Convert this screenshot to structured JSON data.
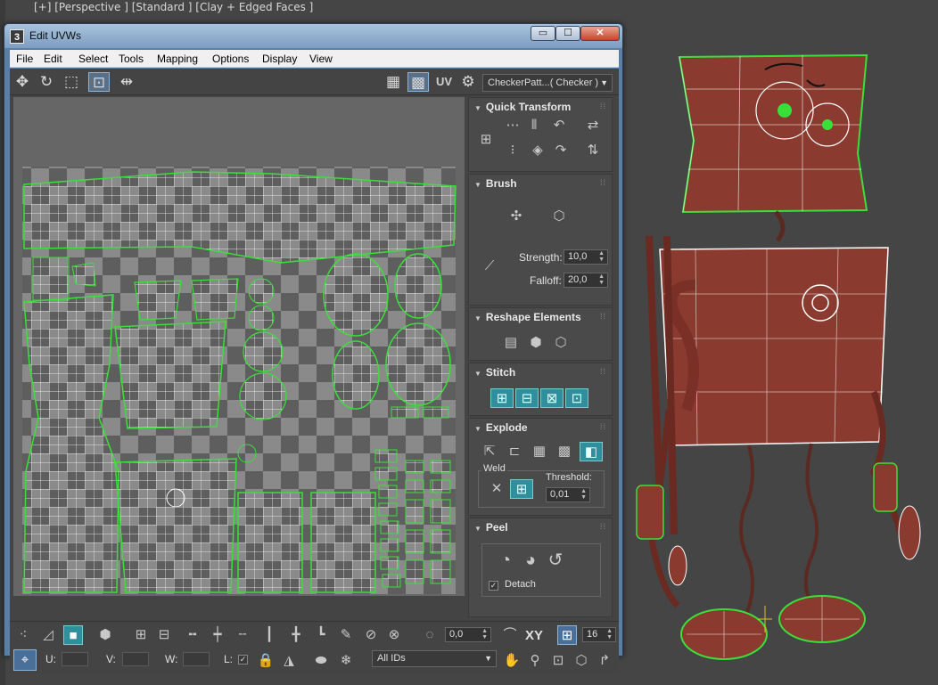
{
  "viewport": {
    "label": "[+] [Perspective ] [Standard ] [Clay + Edged Faces ]"
  },
  "window": {
    "app_icon": "3",
    "title": "Edit UVWs",
    "minimize_glyph": "▭",
    "maximize_glyph": "☐",
    "close_glyph": "✕"
  },
  "menubar": {
    "items": [
      "File",
      "Edit",
      "Select",
      "Tools",
      "Mapping",
      "Options",
      "Display",
      "View"
    ]
  },
  "toolbar_top": {
    "icons": [
      "move-icon",
      "rotate-icon",
      "scale-icon",
      "freeform-icon",
      "mirror-icon",
      "checker-icon",
      "checker-uv-icon",
      "settings-icon"
    ],
    "uv_label": "UV",
    "checker_map": "CheckerPatt...( Checker )"
  },
  "panel": {
    "quick_transform": {
      "title": "Quick Transform"
    },
    "brush": {
      "title": "Brush",
      "strength_label": "Strength:",
      "strength_value": "10,0",
      "falloff_label": "Falloff:",
      "falloff_value": "20,0"
    },
    "reshape": {
      "title": "Reshape Elements"
    },
    "stitch": {
      "title": "Stitch"
    },
    "explode": {
      "title": "Explode",
      "weld_label": "Weld",
      "threshold_label": "Threshold:",
      "threshold_value": "0,01"
    },
    "peel": {
      "title": "Peel",
      "detach_label": "Detach"
    }
  },
  "toolbar_bottom": {
    "spinner_value": "0,0",
    "xy_label": "XY",
    "grid_value": "16",
    "u_label": "U:",
    "v_label": "V:",
    "w_label": "W:",
    "l_label": "L:",
    "ids_select": "All IDs"
  },
  "colors": {
    "uv_edge_white": "#ffffff",
    "uv_border_green": "#3ae03a",
    "checker_dark": "#5e5e5e",
    "checker_light": "#8a8a8a",
    "accent_teal": "#2f8f9c",
    "title_blue": "#7d9dc0",
    "robot_red": "#8a3a2e"
  }
}
